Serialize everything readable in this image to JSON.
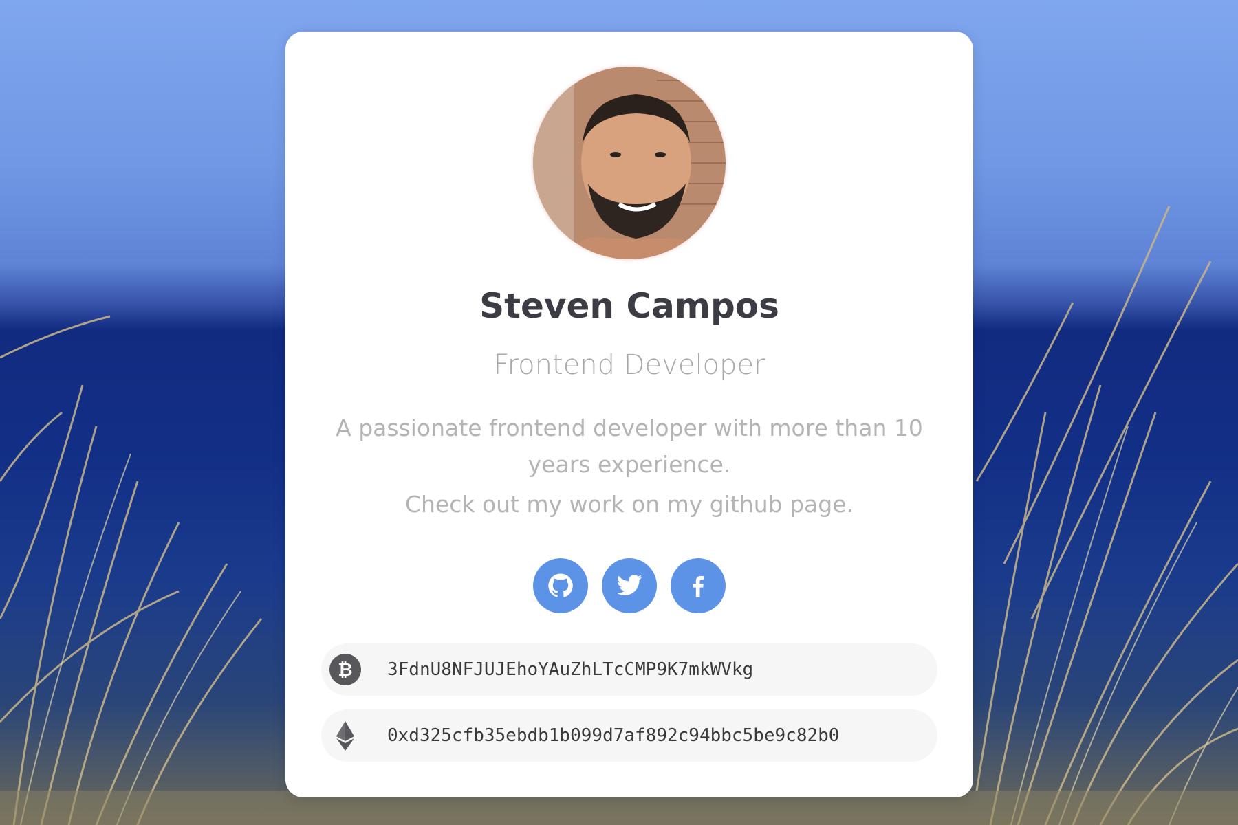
{
  "profile": {
    "name": "Steven Campos",
    "role": "Frontend Developer",
    "bio": "A passionate frontend developer with more than 10 years experience.",
    "bio_secondary": "Check out my work on my github page."
  },
  "socials": [
    {
      "icon": "github-icon",
      "label": "GitHub"
    },
    {
      "icon": "twitter-icon",
      "label": "Twitter"
    },
    {
      "icon": "facebook-icon",
      "label": "Facebook"
    }
  ],
  "wallets": {
    "bitcoin": {
      "icon": "bitcoin-icon",
      "address": "3FdnU8NFJUJEhoYAuZhLTcCMP9K7mkWVkg"
    },
    "ethereum": {
      "icon": "ethereum-icon",
      "address": "0xd325cfb35ebdb1b099d7af892c94bbc5be9c82b0"
    }
  },
  "colors": {
    "accent": "#5d93e6",
    "name": "#3c3c44",
    "muted": "#b4b4b4",
    "card": "#ffffff",
    "wallet_bg": "#f6f6f6"
  }
}
